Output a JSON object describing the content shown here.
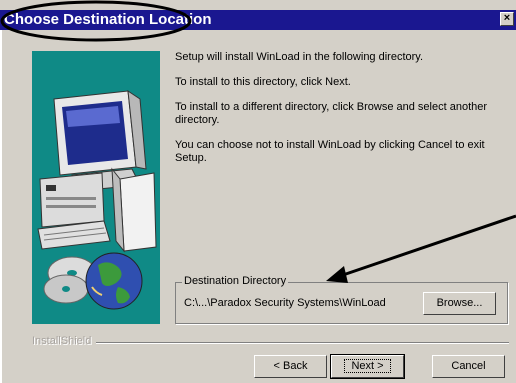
{
  "window": {
    "title": "Choose Destination Location",
    "close_glyph": "×"
  },
  "body": {
    "para1": "Setup will install WinLoad in the following directory.",
    "para2": "To install to this directory, click Next.",
    "para3": "To install to a different directory, click Browse and select another directory.",
    "para4": "You can choose not to install WinLoad by clicking Cancel to exit Setup."
  },
  "destination": {
    "group_label": "Destination Directory",
    "path": "C:\\...\\Paradox Security Systems\\WinLoad",
    "browse_label": "Browse..."
  },
  "footer": {
    "brand": "InstallShield",
    "back_label": "< Back",
    "next_label": "Next >",
    "cancel_label": "Cancel"
  },
  "icons": {
    "close": "close-icon",
    "art": "computer-with-disks-illustration"
  },
  "colors": {
    "titlebar": "#1a1790",
    "panel": "#d4d0c8",
    "art_background": "#0f8a86"
  }
}
